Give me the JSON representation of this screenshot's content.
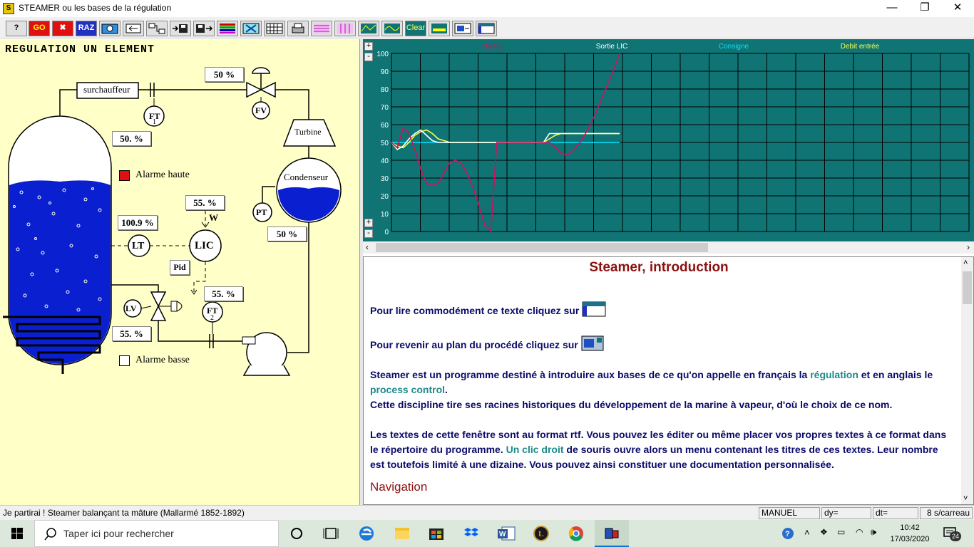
{
  "window": {
    "title": "STEAMER ou les bases de la régulation",
    "min": "—",
    "max": "❐",
    "close": "✕"
  },
  "toolbar": {
    "help": "?",
    "go": "GO",
    "stop": "✖",
    "raz": "RAZ",
    "clear": "Clear"
  },
  "diagram": {
    "title": "REGULATION UN ELEMENT",
    "surchauffeur": "surchauffeur",
    "turbine": "Turbine",
    "condenseur": "Condenseur",
    "alarme_haute": "Alarme haute",
    "alarme_basse": "Alarme basse",
    "fv_value": "50 %",
    "ft1_value": "50. %",
    "lic_setpoint": "55. %",
    "lt_value": "100.9 %",
    "condenser_value": "50 %",
    "lic_output": "55. %",
    "feed_value": "55. %",
    "pid_label": "Pid",
    "w_label": "W",
    "ft1_label": "FT",
    "ft1_sub": "1",
    "ft2_label": "FT",
    "ft2_sub": "2",
    "fv_label": "FV",
    "pt_label": "PT",
    "lt_label": "LT",
    "lic_label": "LIC",
    "lv_label": "LV"
  },
  "chart_data": {
    "type": "line",
    "legend": [
      {
        "name": "Niveau",
        "color": "#d01060"
      },
      {
        "name": "Sortie LIC",
        "color": "#ffffff"
      },
      {
        "name": "Consigne",
        "color": "#00e0ff"
      },
      {
        "name": "Debit entrée",
        "color": "#ffff40"
      }
    ],
    "ylim": [
      0,
      100
    ],
    "yticks": [
      "100",
      "90",
      "80",
      "70",
      "60",
      "50",
      "40",
      "30",
      "20",
      "10",
      "0"
    ],
    "grid": true,
    "x_divisions": 20,
    "series": [
      {
        "name": "Niveau",
        "values": [
          50,
          47,
          58,
          55,
          46,
          35,
          27,
          26,
          27,
          33,
          39,
          40,
          38,
          32,
          24,
          14,
          3,
          0,
          50,
          50,
          50,
          50,
          50,
          50,
          50,
          50,
          50,
          50,
          47,
          44,
          43,
          45,
          49,
          54,
          60,
          67,
          75,
          83,
          91,
          100
        ]
      },
      {
        "name": "Sortie LIC",
        "values": [
          50,
          46,
          48,
          52,
          55,
          57,
          54,
          51,
          50,
          50,
          50,
          50,
          50,
          50,
          50,
          50,
          50,
          50,
          50,
          50,
          50,
          50,
          50,
          50,
          50,
          50,
          50,
          55,
          55,
          55,
          55,
          55,
          55,
          55,
          55,
          55,
          55,
          55,
          55,
          55
        ]
      },
      {
        "name": "Consigne",
        "values": [
          50,
          50,
          50,
          50,
          50,
          50,
          50,
          50,
          50,
          50,
          50,
          50,
          50,
          50,
          50,
          50,
          50,
          50,
          50,
          50,
          50,
          50,
          50,
          50,
          50,
          50,
          50,
          50,
          50,
          50,
          50,
          50,
          50,
          50,
          50,
          50,
          50,
          50,
          50,
          50
        ]
      },
      {
        "name": "Debit entrée",
        "values": [
          50,
          48,
          47,
          50,
          54,
          56,
          57,
          55,
          52,
          51,
          50,
          50,
          50,
          50,
          50,
          50,
          50,
          50,
          50,
          50,
          50,
          50,
          50,
          50,
          50,
          50,
          50,
          52,
          54,
          55,
          55,
          55,
          55,
          55,
          55,
          55,
          55,
          55,
          55,
          55
        ]
      }
    ]
  },
  "doc": {
    "title": "Steamer, introduction",
    "line1": "Pour lire commodément ce texte cliquez sur",
    "line2": "Pour revenir au plan du procédé cliquez sur",
    "p1a": "Steamer est un programme destiné à introduire aux bases de ce qu'on appelle en français la ",
    "p1_link1": "régulation",
    "p1b": " et en anglais le ",
    "p1_link2": "process control",
    "p1c": ".",
    "p2": "Cette discipline tire ses racines historiques du développement de la marine à vapeur, d'où le choix de ce nom.",
    "p3a": "Les textes de cette fenêtre sont au format rtf. Vous pouvez les éditer ou même placer vos propres textes à ce format dans le répertoire du programme. ",
    "p3_link": "Un clic droit",
    "p3b": " de souris ouvre alors un menu contenant les titres de ces textes. Leur nombre est toutefois limité à une dizaine. Vous pouvez ainsi constituer une documentation personnalisée.",
    "next_heading": "Navigation"
  },
  "status": {
    "quote": "Je partirai ! Steamer balançant ta mâture  (Mallarmé 1852-1892)",
    "mode": "MANUEL",
    "dy": "dy=",
    "dt": "dt=",
    "scale": "8 s/carreau"
  },
  "taskbar": {
    "search_placeholder": "Taper ici pour rechercher",
    "time": "10:42",
    "date": "17/03/2020",
    "notif_count": "24"
  }
}
